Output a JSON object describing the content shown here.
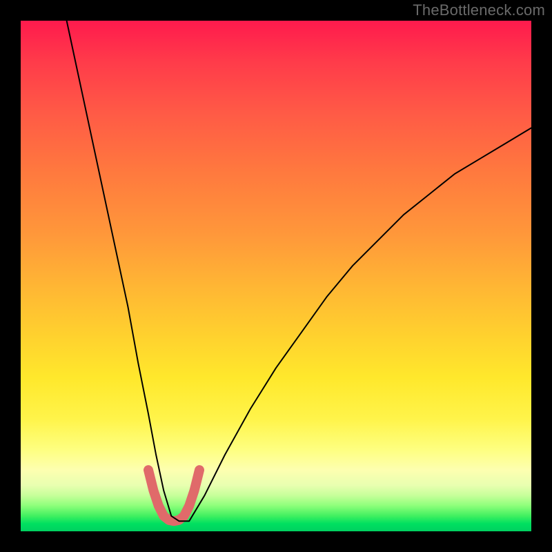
{
  "watermark": "TheBottleneck.com",
  "chart_data": {
    "type": "line",
    "title": "",
    "xlabel": "",
    "ylabel": "",
    "xlim": [
      0,
      100
    ],
    "ylim": [
      0,
      100
    ],
    "series": [
      {
        "name": "primary-curve",
        "x": [
          9,
          12,
          15,
          18,
          21,
          23,
          25,
          26.5,
          28,
          29.5,
          31,
          33,
          36,
          40,
          45,
          50,
          55,
          60,
          65,
          70,
          75,
          80,
          85,
          90,
          95,
          100
        ],
        "y": [
          100,
          86,
          72,
          58,
          44,
          33,
          23,
          15,
          8,
          3,
          2,
          2,
          7,
          15,
          24,
          32,
          39,
          46,
          52,
          57,
          62,
          66,
          70,
          73,
          76,
          79
        ],
        "stroke": "#000000",
        "stroke_width": 2
      },
      {
        "name": "bottom-highlight",
        "x": [
          25,
          26,
          27,
          28,
          29,
          30,
          31,
          32,
          33,
          34,
          35
        ],
        "y": [
          12,
          8,
          5,
          3,
          2.2,
          2,
          2.2,
          3,
          5,
          8,
          12
        ],
        "stroke": "#e06a6a",
        "stroke_width": 14
      }
    ],
    "gradient_stops": [
      {
        "pos": 0,
        "color": "#ff1a4d"
      },
      {
        "pos": 30,
        "color": "#ff7a3e"
      },
      {
        "pos": 62,
        "color": "#ffd22e"
      },
      {
        "pos": 88,
        "color": "#fdffb0"
      },
      {
        "pos": 100,
        "color": "#00d060"
      }
    ]
  }
}
